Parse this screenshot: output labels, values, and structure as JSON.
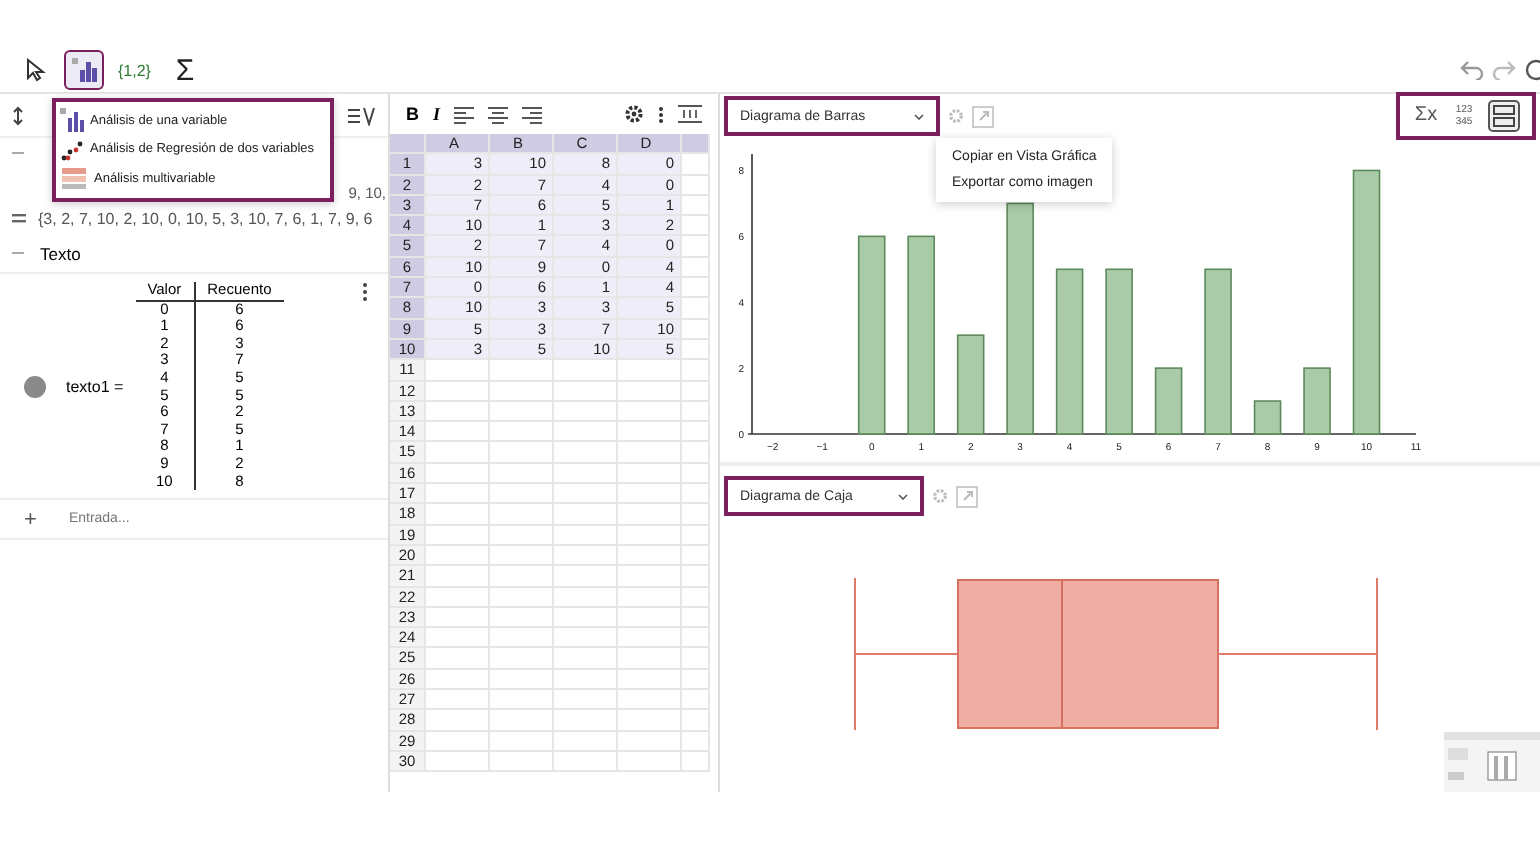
{
  "toolbar": {
    "tools": [
      {
        "kind": "pointer",
        "selected": false
      },
      {
        "kind": "stats",
        "selected": true
      },
      {
        "kind": "list",
        "label": "{1,2}",
        "selected": false
      },
      {
        "kind": "sum",
        "label": "Σ",
        "selected": false
      }
    ]
  },
  "stats_menu": {
    "items": [
      {
        "kind": "one",
        "label": "Análisis de una variable"
      },
      {
        "kind": "two",
        "label": "Análisis de Regresión de dos variables"
      },
      {
        "kind": "multi",
        "label": "Análisis multivariable"
      }
    ]
  },
  "algebra": {
    "list_fragment": "9, 10,",
    "list_line": "{3, 2, 7, 10, 2, 10, 0, 10, 5, 3, 10, 7, 6, 1, 7, 9, 6",
    "section": "Texto",
    "object_name": "texto1 =",
    "table_headers": [
      "Valor",
      "Recuento"
    ],
    "table_rows": [
      [
        "0",
        "6"
      ],
      [
        "1",
        "6"
      ],
      [
        "2",
        "3"
      ],
      [
        "3",
        "7"
      ],
      [
        "4",
        "5"
      ],
      [
        "5",
        "5"
      ],
      [
        "6",
        "2"
      ],
      [
        "7",
        "5"
      ],
      [
        "8",
        "1"
      ],
      [
        "9",
        "2"
      ],
      [
        "10",
        "8"
      ]
    ],
    "add_label": "+",
    "input_placeholder": "Entrada..."
  },
  "spreadsheet": {
    "format_buttons": [
      "B",
      "I"
    ],
    "columns": [
      "A",
      "B",
      "C",
      "D",
      ""
    ],
    "rows": [
      [
        "3",
        "10",
        "8",
        "0"
      ],
      [
        "2",
        "7",
        "4",
        "0"
      ],
      [
        "7",
        "6",
        "5",
        "1"
      ],
      [
        "10",
        "1",
        "3",
        "2"
      ],
      [
        "2",
        "7",
        "4",
        "0"
      ],
      [
        "10",
        "9",
        "0",
        "4"
      ],
      [
        "0",
        "6",
        "1",
        "4"
      ],
      [
        "10",
        "3",
        "3",
        "5"
      ],
      [
        "5",
        "3",
        "7",
        "10"
      ],
      [
        "3",
        "5",
        "10",
        "5"
      ]
    ],
    "row_numbers": [
      "1",
      "2",
      "3",
      "4",
      "5",
      "6",
      "7",
      "8",
      "9",
      "10",
      "11",
      "12",
      "13",
      "14",
      "15",
      "16",
      "17",
      "18",
      "19",
      "20",
      "21",
      "22",
      "23",
      "24",
      "25",
      "26",
      "27",
      "28",
      "29",
      "30"
    ]
  },
  "bar_panel": {
    "dropdown": "Diagrama de Barras",
    "context_menu": [
      "Copiar en Vista Gráfica",
      "Exportar como imagen"
    ],
    "stats_label": "Σx",
    "table_label": "123\n345",
    "chart_data": {
      "type": "bar",
      "x": [
        0,
        1,
        2,
        3,
        4,
        5,
        6,
        7,
        8,
        9,
        10
      ],
      "values": [
        6,
        6,
        3,
        7,
        5,
        5,
        2,
        5,
        1,
        2,
        8
      ],
      "xticks": [
        {
          "value": -2,
          "label": "−2"
        },
        {
          "value": -1,
          "label": "−1"
        },
        0,
        1,
        2,
        3,
        4,
        5,
        6,
        7,
        8,
        9,
        10,
        11
      ],
      "yticks": [
        0,
        2,
        4,
        6,
        8
      ],
      "xlim": [
        -2.5,
        11
      ],
      "ylim": [
        0,
        8.5
      ]
    }
  },
  "box_panel": {
    "dropdown": "Diagrama de Caja"
  }
}
